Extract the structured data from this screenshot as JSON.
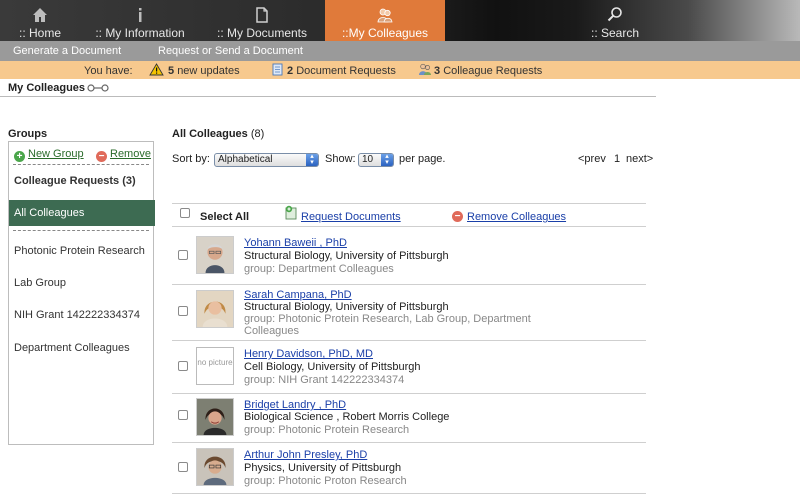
{
  "nav": {
    "tabs": [
      {
        "label": ":: Home",
        "icon": "home-icon"
      },
      {
        "label": ":: My Information",
        "icon": "info-icon"
      },
      {
        "label": ":: My Documents",
        "icon": "document-icon"
      },
      {
        "label": "::My Colleagues",
        "icon": "colleagues-icon"
      },
      {
        "label": ":: Search",
        "icon": "search-icon"
      }
    ],
    "active_color": "#e07a3a"
  },
  "subnav": {
    "generate": "Generate a Document",
    "request": "Request or Send a Document"
  },
  "updates": {
    "prefix": "You have:",
    "new_updates_count": "5",
    "new_updates_label": "new updates",
    "doc_requests_count": "2",
    "doc_requests_label": "Document Requests",
    "colleague_requests_count": "3",
    "colleague_requests_label": "Colleague Requests"
  },
  "breadcrumb": "My Colleagues",
  "groups": {
    "title": "Groups",
    "new_group": "New Group",
    "remove": "Remove",
    "colleague_requests": "Colleague Requests (3)",
    "active": "All Colleagues",
    "items": [
      "Photonic Protein Research",
      "Lab Group",
      "NIH Grant 142222334374",
      "Department Colleagues"
    ]
  },
  "list": {
    "title": "All Colleagues",
    "count": "(8)",
    "sort_label": "Sort by:",
    "sort_value": "Alphabetical",
    "show_label": "Show:",
    "show_value": "10",
    "per_page": "per page.",
    "prev": "<prev",
    "page": "1",
    "next": "next>",
    "select_all": "Select All",
    "request_documents": "Request Documents",
    "remove_colleagues": "Remove Colleagues",
    "no_picture": "no picture",
    "colleagues": [
      {
        "name": "Yohann Baweii , PhD",
        "affiliation": "Structural Biology, University of Pittsburgh",
        "group": "group: Department Colleagues"
      },
      {
        "name": "Sarah Campana, PhD",
        "affiliation": "Structural Biology, University of Pittsburgh",
        "group": "group: Photonic Protein Research, Lab Group, Department Colleagues"
      },
      {
        "name": "Henry Davidson, PhD, MD",
        "affiliation": "Cell Biology, University of Pittsburgh",
        "group": "group: NIH Grant 142222334374"
      },
      {
        "name": "Bridget Landry , PhD",
        "affiliation": "Biological Science , Robert Morris College",
        "group": "group: Photonic Protein Research"
      },
      {
        "name": "Arthur John Presley, PhD",
        "affiliation": "Physics, University of Pittsburgh",
        "group": "group: Photonic Proton Research"
      }
    ]
  }
}
